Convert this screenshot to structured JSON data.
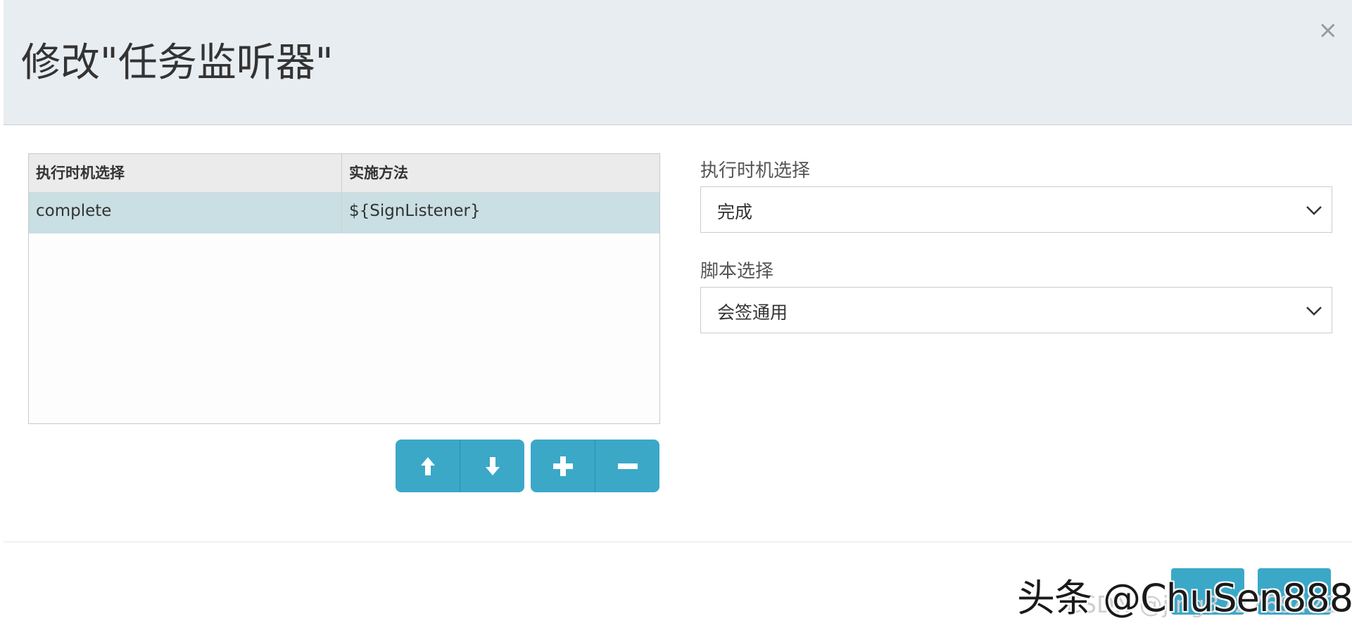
{
  "dialog": {
    "title": "修改\"任务监听器\"",
    "close_label": "×"
  },
  "table": {
    "columns": [
      "执行时机选择",
      "实施方法"
    ],
    "rows": [
      [
        "complete",
        "${SignListener}"
      ]
    ]
  },
  "toolbar": {
    "move_up_icon": "arrow-up-icon",
    "move_down_icon": "arrow-down-icon",
    "add_icon": "plus-icon",
    "remove_icon": "minus-icon"
  },
  "form": {
    "timing_label": "执行时机选择",
    "timing_value": "完成",
    "script_label": "脚本选择",
    "script_value": "会签通用"
  },
  "watermark": {
    "line1": "头条 @ChuSen888",
    "line2": "CSDN @jing372769422"
  },
  "colors": {
    "header_bg": "#e8edf1",
    "accent": "#3ba8c8",
    "selected_row": "#c9dfe3"
  }
}
